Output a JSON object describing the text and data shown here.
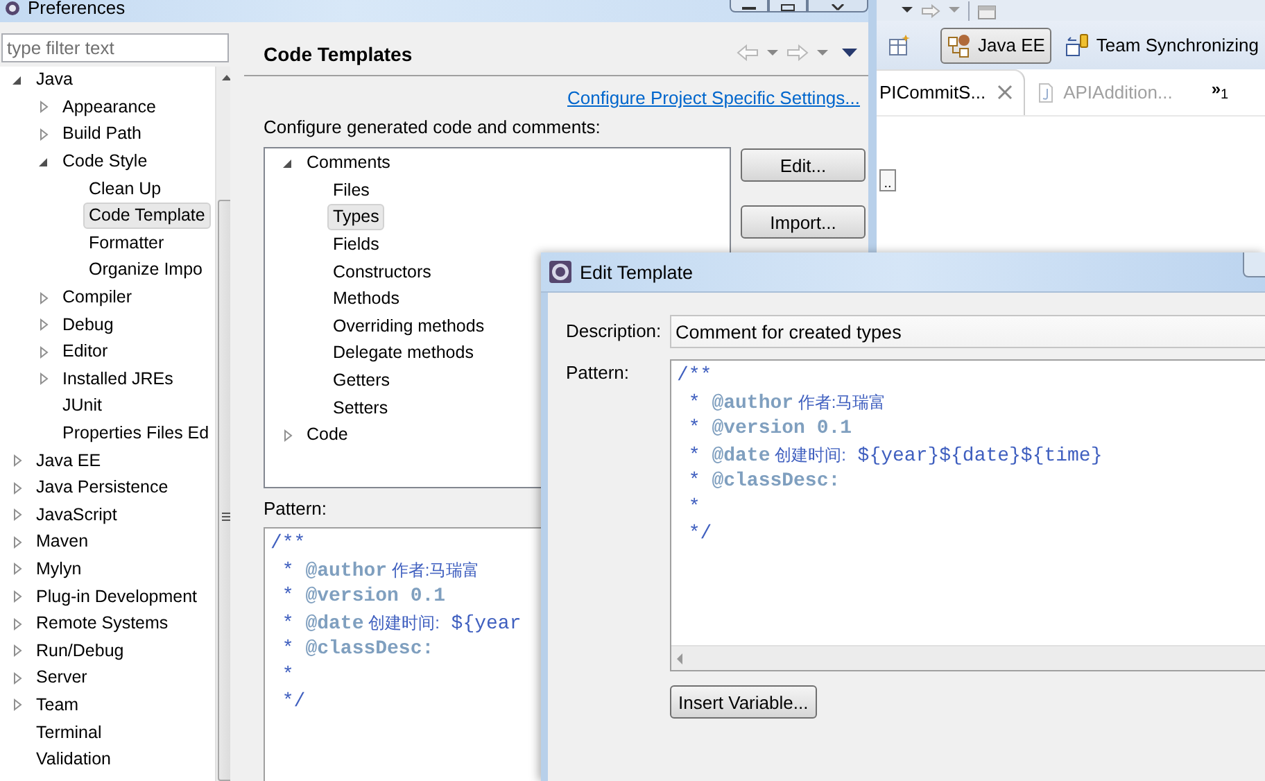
{
  "preferences": {
    "title": "Preferences",
    "filter": {
      "placeholder": "type filter text"
    },
    "tree": [
      {
        "label": "Java",
        "expanded": true,
        "selected": false,
        "children": [
          {
            "label": "Appearance",
            "expanded": false,
            "selected": false
          },
          {
            "label": "Build Path",
            "expanded": false,
            "selected": false
          },
          {
            "label": "Code Style",
            "expanded": true,
            "selected": false,
            "children": [
              {
                "label": "Clean Up",
                "selected": false
              },
              {
                "label": "Code Template",
                "selected": true
              },
              {
                "label": "Formatter",
                "selected": false
              },
              {
                "label": "Organize Impo",
                "selected": false
              }
            ]
          },
          {
            "label": "Compiler",
            "expanded": false,
            "selected": false
          },
          {
            "label": "Debug",
            "expanded": false,
            "selected": false
          },
          {
            "label": "Editor",
            "expanded": false,
            "selected": false
          },
          {
            "label": "Installed JREs",
            "expanded": false,
            "selected": false
          },
          {
            "label": "JUnit",
            "selected": false
          },
          {
            "label": "Properties Files Ed",
            "selected": false
          }
        ]
      },
      {
        "label": "Java EE",
        "expanded": false,
        "selected": false
      },
      {
        "label": "Java Persistence",
        "expanded": false,
        "selected": false
      },
      {
        "label": "JavaScript",
        "expanded": false,
        "selected": false
      },
      {
        "label": "Maven",
        "expanded": false,
        "selected": false
      },
      {
        "label": "Mylyn",
        "expanded": false,
        "selected": false
      },
      {
        "label": "Plug-in Development",
        "expanded": false,
        "selected": false
      },
      {
        "label": "Remote Systems",
        "expanded": false,
        "selected": false
      },
      {
        "label": "Run/Debug",
        "expanded": false,
        "selected": false
      },
      {
        "label": "Server",
        "expanded": false,
        "selected": false
      },
      {
        "label": "Team",
        "expanded": false,
        "selected": false
      },
      {
        "label": "Terminal",
        "selected": false
      },
      {
        "label": "Validation",
        "selected": false
      }
    ],
    "page": {
      "title": "Code Templates",
      "link": "Configure Project Specific Settings...",
      "description": "Configure generated code and comments:",
      "templates": [
        {
          "label": "Comments",
          "expanded": true,
          "selected": false,
          "children": [
            {
              "label": "Files",
              "selected": false
            },
            {
              "label": "Types",
              "selected": true
            },
            {
              "label": "Fields",
              "selected": false
            },
            {
              "label": "Constructors",
              "selected": false
            },
            {
              "label": "Methods",
              "selected": false
            },
            {
              "label": "Overriding methods",
              "selected": false
            },
            {
              "label": "Delegate methods",
              "selected": false
            },
            {
              "label": "Getters",
              "selected": false
            },
            {
              "label": "Setters",
              "selected": false
            }
          ]
        },
        {
          "label": "Code",
          "expanded": false,
          "selected": false
        }
      ],
      "buttons": [
        "Edit...",
        "Import..."
      ],
      "pattern_label": "Pattern:",
      "pattern": [
        [
          {
            "kind": "comment",
            "text": "/**"
          }
        ],
        [
          {
            "kind": "comment",
            "text": " * "
          },
          {
            "kind": "tag",
            "text": "@author"
          },
          {
            "kind": "cjk",
            "text": " 作者:马瑞富"
          }
        ],
        [
          {
            "kind": "comment",
            "text": " * "
          },
          {
            "kind": "tag",
            "text": "@version"
          },
          {
            "kind": "tag",
            "text": " 0.1"
          }
        ],
        [
          {
            "kind": "comment",
            "text": " * "
          },
          {
            "kind": "tag",
            "text": "@date"
          },
          {
            "kind": "cjk",
            "text": " 创建时间:"
          },
          {
            "kind": "comment",
            "text": " ${year"
          }
        ],
        [
          {
            "kind": "comment",
            "text": " * "
          },
          {
            "kind": "tag",
            "text": "@classDesc:"
          }
        ],
        [
          {
            "kind": "comment",
            "text": " *"
          }
        ],
        [
          {
            "kind": "comment",
            "text": " */"
          }
        ]
      ]
    }
  },
  "workbench": {
    "perspectives": [
      {
        "label": "Java EE",
        "selected": true
      },
      {
        "label": "Team Synchronizing",
        "selected": false
      }
    ],
    "tabs": [
      {
        "label": "PICommitS...",
        "selected": true
      },
      {
        "label": "APIAddition...",
        "selected": false
      }
    ],
    "overflow": {
      "symbol": "»",
      "count": "1"
    },
    "more_button": ".."
  },
  "edit_template": {
    "title": "Edit Template",
    "description_label": "Description:",
    "description": "Comment for created types",
    "pattern_label": "Pattern:",
    "pattern": [
      [
        {
          "kind": "comment",
          "text": "/**"
        }
      ],
      [
        {
          "kind": "comment",
          "text": " * "
        },
        {
          "kind": "tag",
          "text": "@author"
        },
        {
          "kind": "cjk",
          "text": " 作者:马瑞富"
        }
      ],
      [
        {
          "kind": "comment",
          "text": " * "
        },
        {
          "kind": "tag",
          "text": "@version"
        },
        {
          "kind": "tag",
          "text": " 0.1"
        }
      ],
      [
        {
          "kind": "comment",
          "text": " * "
        },
        {
          "kind": "tag",
          "text": "@date"
        },
        {
          "kind": "cjk",
          "text": " 创建时间:"
        },
        {
          "kind": "comment",
          "text": " ${year}${date}${time}"
        }
      ],
      [
        {
          "kind": "comment",
          "text": " * "
        },
        {
          "kind": "tag",
          "text": "@classDesc:"
        }
      ],
      [
        {
          "kind": "comment",
          "text": " *"
        }
      ],
      [
        {
          "kind": "comment",
          "text": " */"
        }
      ]
    ],
    "button": "Insert Variable..."
  }
}
